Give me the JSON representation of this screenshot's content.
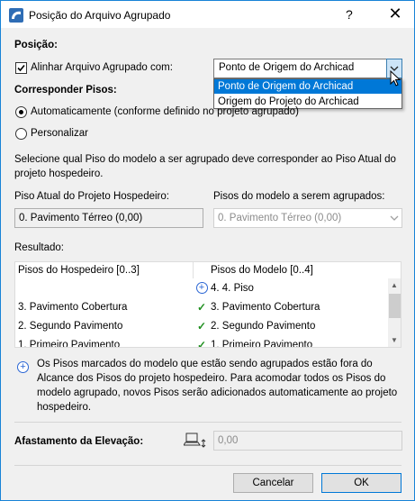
{
  "window": {
    "title": "Posição do Arquivo Agrupado",
    "help": "?",
    "close": "✕"
  },
  "position": {
    "heading": "Posição:",
    "align_label": "Alinhar Arquivo Agrupado com:",
    "align_checked": true,
    "selected": "Ponto de Origem do Archicad",
    "options": [
      "Ponto de Origem do Archicad",
      "Origem do Projeto do Archicad"
    ]
  },
  "floors": {
    "heading": "Corresponder Pisos:",
    "auto_label": "Automaticamente (conforme definido no projeto agrupado)",
    "custom_label": "Personalizar",
    "description": "Selecione qual Piso do modelo a ser agrupado deve corresponder ao Piso Atual do projeto hospedeiro.",
    "host_label": "Piso Atual do Projeto Hospedeiro:",
    "host_value": "0. Pavimento Térreo (0,00)",
    "model_label": "Pisos do modelo a serem agrupados:",
    "model_value": "0. Pavimento Térreo (0,00)"
  },
  "result": {
    "heading": "Resultado:",
    "col_host": "Pisos do Hospedeiro [0..3]",
    "col_model": "Pisos do Modelo [0..4]",
    "rows": [
      {
        "host": "",
        "status": "plus",
        "model": "4. 4. Piso"
      },
      {
        "host": "3. Pavimento Cobertura",
        "status": "check",
        "model": "3. Pavimento Cobertura"
      },
      {
        "host": "2. Segundo Pavimento",
        "status": "check",
        "model": "2. Segundo Pavimento"
      },
      {
        "host": "1. Primeiro Pavimento",
        "status": "check",
        "model": "1. Primeiro Pavimento"
      }
    ],
    "note": "Os Pisos marcados do modelo que estão sendo agrupados estão fora do Alcance dos Pisos do projeto hospedeiro. Para acomodar todos os Pisos do modelo agrupado, novos Pisos serão adicionados automaticamente ao projeto hospedeiro."
  },
  "elevation": {
    "label": "Afastamento da Elevação:",
    "value": "0,00"
  },
  "buttons": {
    "cancel": "Cancelar",
    "ok": "OK"
  },
  "colors": {
    "accent": "#0078d7",
    "check": "#1f8f1f",
    "plus": "#2b66d4"
  }
}
